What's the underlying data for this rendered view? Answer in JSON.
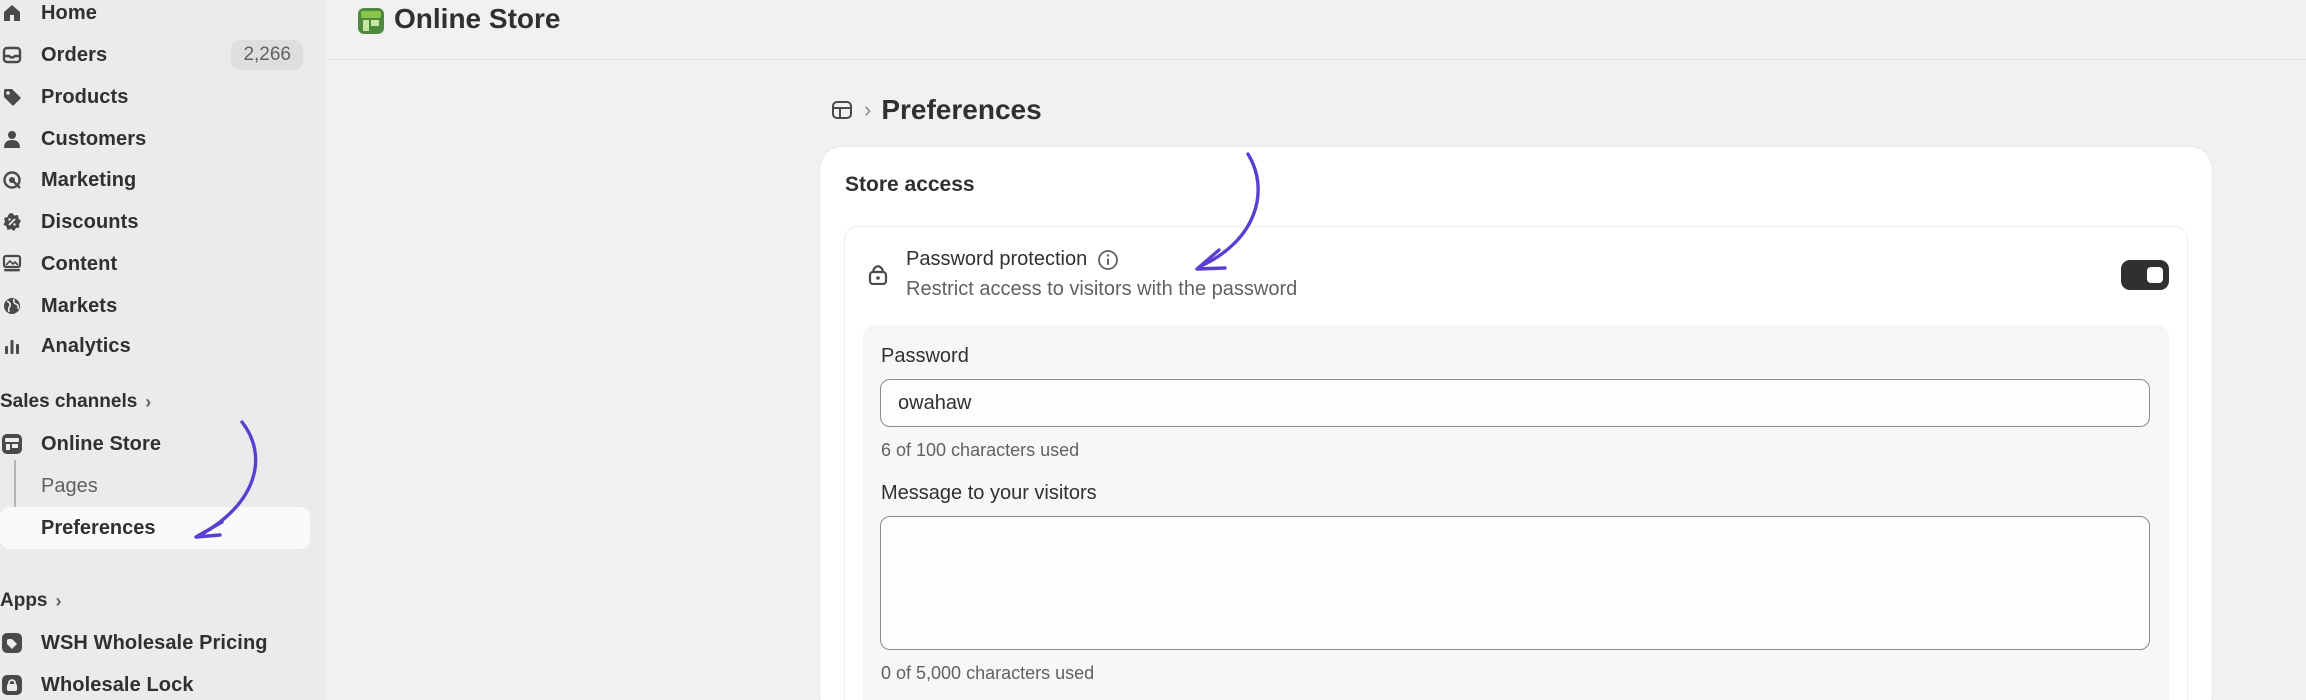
{
  "sidebar": {
    "items": [
      {
        "label": "Home",
        "icon": "home-icon"
      },
      {
        "label": "Orders",
        "icon": "inbox-icon",
        "badge": "2,266"
      },
      {
        "label": "Products",
        "icon": "tag-icon"
      },
      {
        "label": "Customers",
        "icon": "person-icon"
      },
      {
        "label": "Marketing",
        "icon": "target-icon"
      },
      {
        "label": "Discounts",
        "icon": "discount-icon"
      },
      {
        "label": "Content",
        "icon": "content-icon"
      },
      {
        "label": "Markets",
        "icon": "globe-icon"
      },
      {
        "label": "Analytics",
        "icon": "bar-chart-icon"
      }
    ],
    "sales_channels": {
      "heading": "Sales channels",
      "online_store": "Online Store",
      "pages": "Pages",
      "preferences": "Preferences"
    },
    "apps": {
      "heading": "Apps",
      "items": [
        {
          "label": "WSH Wholesale Pricing"
        },
        {
          "label": "Wholesale Lock"
        }
      ]
    }
  },
  "topbar": {
    "title": "Online Store"
  },
  "breadcrumb": {
    "title": "Preferences"
  },
  "store_access": {
    "title": "Store access",
    "password_protection": {
      "title": "Password protection",
      "description": "Restrict access to visitors with the password",
      "enabled": true
    },
    "password": {
      "label": "Password",
      "value": "owahaw",
      "help": "6 of 100 characters used"
    },
    "message": {
      "label": "Message to your visitors",
      "value": "",
      "help": "0 of 5,000 characters used"
    }
  },
  "colors": {
    "annotation_arrow": "#5b3fd1",
    "toggle_on": "#303030",
    "sidebar_bg": "#ebebeb"
  }
}
